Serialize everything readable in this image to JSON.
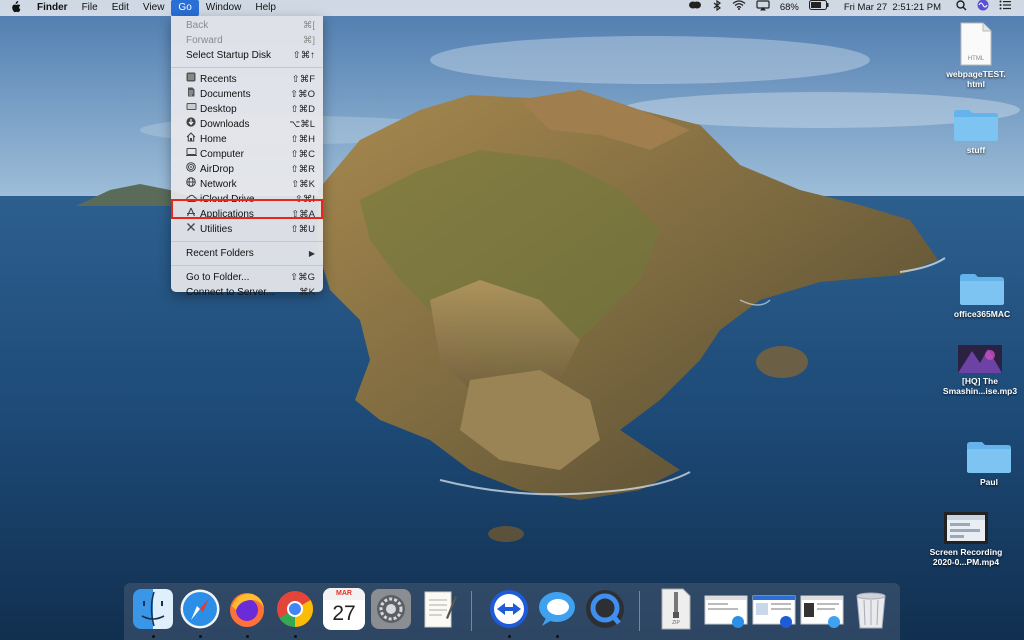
{
  "menubar": {
    "app_name": "Finder",
    "menus": [
      "File",
      "Edit",
      "View",
      "Go",
      "Window",
      "Help"
    ],
    "status": {
      "battery": "68%",
      "datetime": "Fri Mar 27  2:51:21 PM"
    }
  },
  "go_menu": {
    "items": [
      {
        "label": "Back",
        "shortcut": "⌘[",
        "disabled": true
      },
      {
        "label": "Forward",
        "shortcut": "⌘]",
        "disabled": true
      },
      {
        "label": "Select Startup Disk",
        "shortcut": "⇧⌘↑"
      },
      {
        "label": "Recents",
        "shortcut": "⇧⌘F",
        "icon": "clock-icon"
      },
      {
        "label": "Documents",
        "shortcut": "⇧⌘O",
        "icon": "document-icon"
      },
      {
        "label": "Desktop",
        "shortcut": "⇧⌘D",
        "icon": "desktop-icon"
      },
      {
        "label": "Downloads",
        "shortcut": "⌥⌘L",
        "icon": "download-icon"
      },
      {
        "label": "Home",
        "shortcut": "⇧⌘H",
        "icon": "home-icon"
      },
      {
        "label": "Computer",
        "shortcut": "⇧⌘C",
        "icon": "computer-icon"
      },
      {
        "label": "AirDrop",
        "shortcut": "⇧⌘R",
        "icon": "airdrop-icon"
      },
      {
        "label": "Network",
        "shortcut": "⇧⌘K",
        "icon": "network-icon"
      },
      {
        "label": "iCloud Drive",
        "shortcut": "⇧⌘I",
        "icon": "cloud-icon"
      },
      {
        "label": "Applications",
        "shortcut": "⇧⌘A",
        "icon": "applications-icon",
        "highlighted": true
      },
      {
        "label": "Utilities",
        "shortcut": "⇧⌘U",
        "icon": "utilities-icon"
      },
      {
        "label": "Recent Folders",
        "submenu": true
      },
      {
        "label": "Go to Folder...",
        "shortcut": "⇧⌘G"
      },
      {
        "label": "Connect to Server...",
        "shortcut": "⌘K"
      }
    ]
  },
  "desktop": {
    "items": [
      {
        "label": "webpageTEST.html",
        "type": "html-file",
        "badge": "HTML"
      },
      {
        "label": "stuff",
        "type": "folder"
      },
      {
        "label": "office365MAC",
        "type": "folder"
      },
      {
        "label": "[HQ] The Smashin...ise.mp3",
        "type": "audio-file"
      },
      {
        "label": "Paul",
        "type": "folder"
      },
      {
        "label": "Screen Recording 2020-0...PM.mp4",
        "type": "video-file"
      }
    ]
  },
  "dock": {
    "apps": [
      "Finder",
      "Safari",
      "Firefox",
      "Chrome",
      "Calendar",
      "System Preferences",
      "TextEdit",
      "TeamViewer",
      "Messages",
      "QuickTime Player",
      "Archive",
      "Safari Window",
      "Browser Window",
      "Messages Window",
      "Trash"
    ],
    "calendar_month": "MAR",
    "calendar_day": "27",
    "archive_label": "ZIP"
  },
  "colors": {
    "highlight_box": "#e8261b",
    "menu_active": "#2a6fd6"
  }
}
